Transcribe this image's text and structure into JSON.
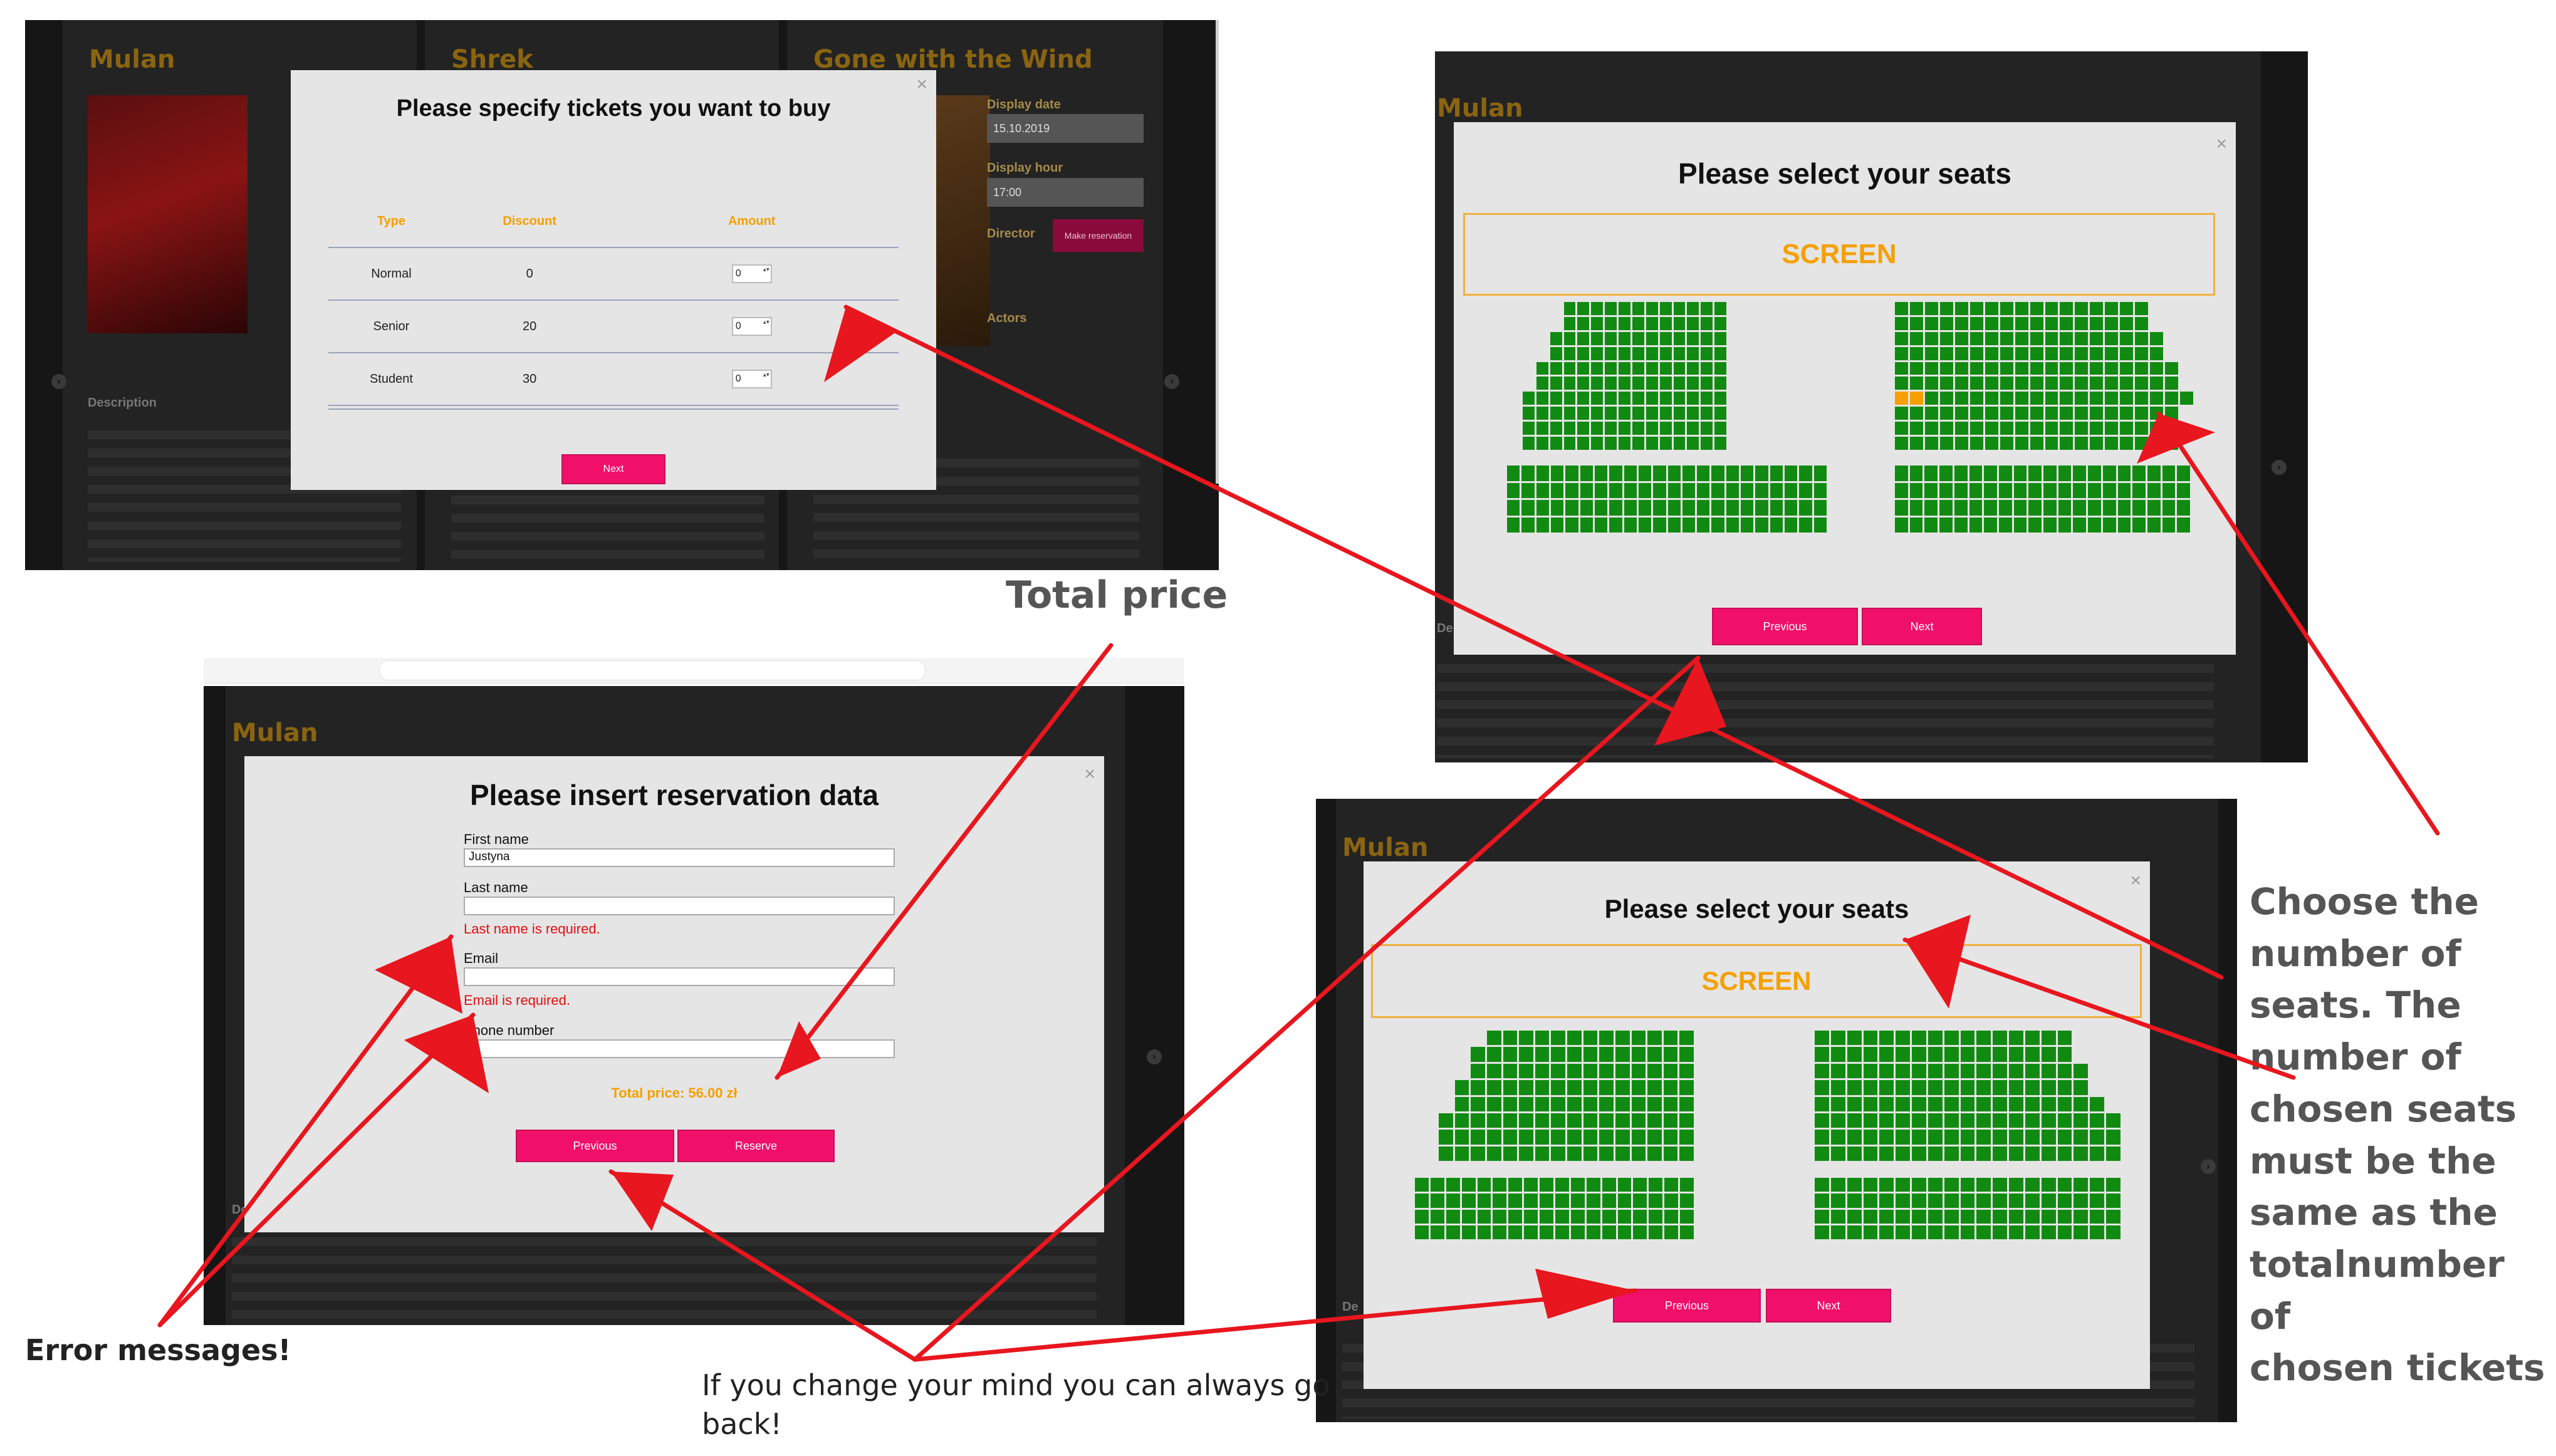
{
  "movies": {
    "mulan": "Mulan",
    "shrek": "Shrek",
    "gone_with_the_wind": "Gone with the Wind"
  },
  "details": {
    "display_date_label": "Display date",
    "display_date_value": "15.10.2019",
    "display_hour_label": "Display hour",
    "display_hour_value": "17:00",
    "director_label": "Director",
    "make_reservation": "Make reservation",
    "actors_label": "Actors",
    "description_label": "Description"
  },
  "tickets_modal": {
    "title": "Please specify tickets you want to buy",
    "columns": [
      "Type",
      "Discount",
      "Amount"
    ],
    "rows": [
      {
        "type": "Normal",
        "discount": "0",
        "amount": "0"
      },
      {
        "type": "Senior",
        "discount": "20",
        "amount": "0"
      },
      {
        "type": "Student",
        "discount": "30",
        "amount": "0"
      }
    ],
    "next": "Next"
  },
  "seats_modal": {
    "title": "Please select your seats",
    "screen": "SCREEN",
    "previous": "Previous",
    "next": "Next"
  },
  "reservation_modal": {
    "title": "Please insert reservation data",
    "first_name_label": "First name",
    "first_name_value": "Justyna",
    "last_name_label": "Last name",
    "last_name_error": "Last name is required.",
    "email_label": "Email",
    "email_error": "Email is required.",
    "phone_label": "Phone number",
    "total_price": "Total price: 56.00 zł",
    "previous": "Previous",
    "reserve": "Reserve"
  },
  "annotations": {
    "total_price": "Total price",
    "error_messages": "Error messages!",
    "go_back_line1": "If you change your mind you can always go",
    "go_back_line2": "back!",
    "choose_seats": [
      "Choose the",
      "number of",
      "seats. The",
      "number of",
      "chosen seats",
      "must be the",
      "same as the",
      "totalnumber of",
      "chosen tickets"
    ]
  },
  "colors": {
    "accent_pink": "#f0106a",
    "seat_green": "#118a11",
    "seat_selected": "#f5a000",
    "arrow_red": "#e8161e"
  }
}
